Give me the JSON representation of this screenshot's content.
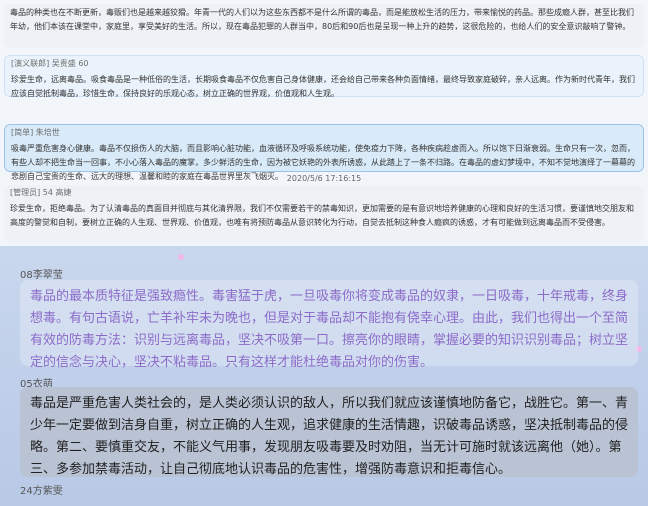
{
  "messages": [
    {
      "header": "",
      "text": "毒品的种类也在不断更新，毒贩们也是越来越狡猾。年青一代的人们以为这些东西都不是什么所谓的毒品，而是能放松生活的压力，带来愉悦的药品。那些成瘾人群，甚至比我们年幼，他们本该在课堂中，家庭里，享受美好的生活。所以，现在毒品犯罪的人群当中，80后和90后也是呈现一种上升的趋势，这很危险的，也给人们的安全意识敲响了警钟。"
    },
    {
      "header": "[演义联郎] 吴贵盛 60",
      "text": "珍爱生命，远离毒品。吸食毒品是一种低俗的生活，长期吸食毒品不仅危害自己身体健康，还会给自己带来各种负面情绪，最终导致家庭破碎，亲人远离。作为新时代青年，我们应该自觉抵制毒品，珍惜生命，保持良好的乐观心态，树立正确的世界观，价值观和人生观。"
    },
    {
      "header": "[简单] 朱培世",
      "text": "吸毒严重危害身心健康。毒品不仅损伤人的大脑，而且影响心脏功能，血液循环及呼吸系统功能，使免疫力下降，各种疾病趁虚而入。所以饱下日渐衰弱。生命只有一次，忽而，有些人却不把生命当一回事，不小心落入毒品的魔掌，多少鲜活的生命，因为被它妖艳的外表所诱惑，从此踏上了一条不归路。在毒品的虚幻梦境中，不知不觉地演绎了一幕幕的悲剧自己宝贵的生命、远大的理想、温馨和睦的家庭在毒品世界里灰飞烟灭。"
    },
    {
      "header": "[管理员] 54 高婕",
      "text": "珍爱生命，拒绝毒品。为了认清毒品的真面目并彻底与其化清界限，我们不仅需要若干的禁毒知识，更加需要的是有意识地培养健康的心理和良好的生活习惯，要谨慎地交朋友和高度的警觉和自制，要树立正确的人生观、世界观、价值观，也唯有将预防毒品从意识转化为行动，自觉去抵制这种食人瘾疯的诱惑，才有可能做到远离毒品而不受侵害。"
    }
  ],
  "timestamp": "2020/5/6 17:16:15",
  "posts": [
    {
      "author": "08李翠莹",
      "text": "毒品的最本质特征是强致瘾性。毒害猛于虎，一旦吸毒你将变成毒品的奴隶，一日吸毒，十年戒毒，终身想毒。有句古语说，亡羊补牢未为晚也，但是对于毒品却不能抱有侥幸心理。由此，我们也得出一个至简有效的防毒方法：识别与远离毒品，坚决不吸第一口。擦亮你的眼睛，掌握必要的知识识别毒品；树立坚定的信念与决心，坚决不粘毒品。只有这样才能杜绝毒品对你的伤害。"
    },
    {
      "author": "05衣萌",
      "text": "毒品是严重危害人类社会的，是人类必须认识的敌人，所以我们就应该谨慎地防备它，战胜它。第一、青少年一定要做到洁身自重，树立正确的人生观，追求健康的生活情趣，识破毒品诱惑，坚决抵制毒品的侵略。第二、要慎重交友，不能义气用事，发现朋友吸毒要及时劝阻，当无计可施时就该远离他（她）。第三、多参加禁毒活动，让自己彻底地认识毒品的危害性，增强防毒意识和拒毒信心。"
    },
    {
      "author": "24方紫雯",
      "text": ""
    }
  ]
}
